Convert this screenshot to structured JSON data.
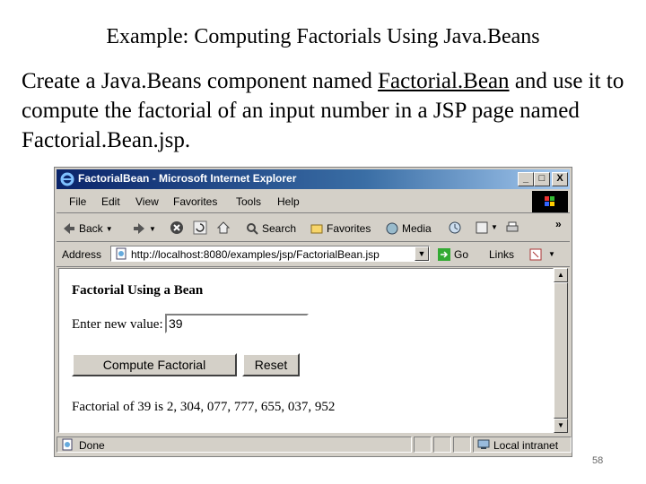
{
  "slide": {
    "title": "Example: Computing Factorials Using Java.Beans",
    "body_1": "Create a Java.Beans component named ",
    "body_link": "Factorial.Bean",
    "body_2": " and use it to compute the factorial of an input number in a JSP page named Factorial.Bean.jsp.",
    "page_number": "58"
  },
  "window": {
    "title": "FactorialBean - Microsoft Internet Explorer",
    "min": "_",
    "max": "□",
    "close": "X"
  },
  "menu": [
    "File",
    "Edit",
    "View",
    "Favorites",
    "Tools",
    "Help"
  ],
  "toolbar": {
    "back": "Back",
    "search": "Search",
    "favorites": "Favorites",
    "media": "Media",
    "chevron": "»"
  },
  "address": {
    "label": "Address",
    "url": "http://localhost:8080/examples/jsp/FactorialBean.jsp",
    "go": "Go",
    "links": "Links",
    "chevron": "»"
  },
  "page": {
    "heading": "Factorial Using a Bean",
    "input_label": "Enter new value:",
    "input_value": "39",
    "compute_button": "Compute Factorial",
    "reset_button": "Reset",
    "result": "Factorial of 39 is 2, 304, 077, 777, 655, 037, 952"
  },
  "status": {
    "left": "Done",
    "zone": "Local intranet"
  }
}
